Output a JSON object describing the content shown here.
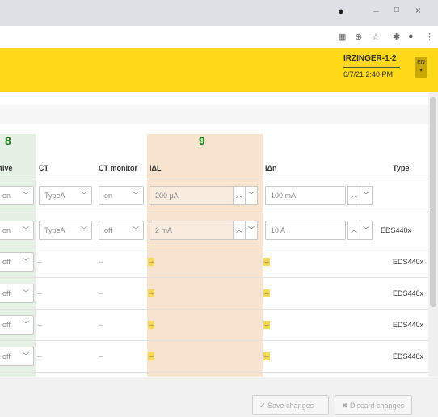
{
  "window": {
    "min": "–",
    "max": "□",
    "close": "×"
  },
  "toolbar_icons": {
    "translate": "▦",
    "zoom": "⊕",
    "star": "☆",
    "ext": "✱",
    "profile": "●",
    "menu": "⋮"
  },
  "header": {
    "device_name": "IRZINGER-1-2",
    "datetime": "6/7/21 2:40 PM",
    "lang": "EN"
  },
  "markers": {
    "m8": "8",
    "m9": "9"
  },
  "columns": {
    "active": "tive",
    "ct": "CT",
    "ct_monitor": "CT monitor",
    "idl": "IΔL",
    "idn": "IΔn",
    "type": "Type"
  },
  "rows": [
    {
      "active": "on",
      "ct": "TypeA",
      "ct_monitor": "on",
      "idl": "200 µA",
      "idn": "100 mA",
      "type": ""
    },
    {
      "active": "on",
      "ct": "TypeA",
      "ct_monitor": "off",
      "idl": "2 mA",
      "idn": "10 A",
      "type": "EDS440x"
    },
    {
      "active": "off",
      "ct": "--",
      "ct_monitor": "--",
      "idl": "--",
      "idn": "--",
      "type": "EDS440x"
    },
    {
      "active": "off",
      "ct": "--",
      "ct_monitor": "--",
      "idl": "--",
      "idn": "--",
      "type": "EDS440x"
    },
    {
      "active": "off",
      "ct": "--",
      "ct_monitor": "--",
      "idl": "--",
      "idn": "--",
      "type": "EDS440x"
    },
    {
      "active": "off",
      "ct": "--",
      "ct_monitor": "--",
      "idl": "--",
      "idn": "--",
      "type": "EDS440x"
    }
  ],
  "footer": {
    "save": "✔ Save changes",
    "discard": "✖ Discard changes"
  }
}
